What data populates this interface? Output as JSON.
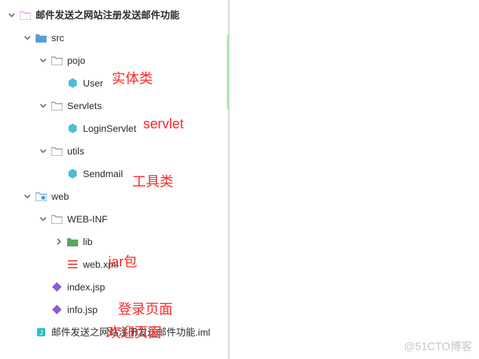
{
  "tree": {
    "root": "邮件发送之网站注册发送邮件功能",
    "src": "src",
    "pojo": "pojo",
    "user": "User",
    "servlets": "Servlets",
    "loginServlet": "LoginServlet",
    "utils": "utils",
    "sendmail": "Sendmail",
    "web": "web",
    "webinf": "WEB-INF",
    "lib": "lib",
    "webxml": "web.xml",
    "indexjsp": "index.jsp",
    "infojsp": "info.jsp",
    "iml": "邮件发送之网站注册发送邮件功能.iml"
  },
  "annotations": {
    "entity": "实体类",
    "servlet": "servlet",
    "util": "工具类",
    "jar": "jar包",
    "login": "登录页面",
    "welcome": "欢迎页面"
  },
  "watermark": "@51CTO博客"
}
